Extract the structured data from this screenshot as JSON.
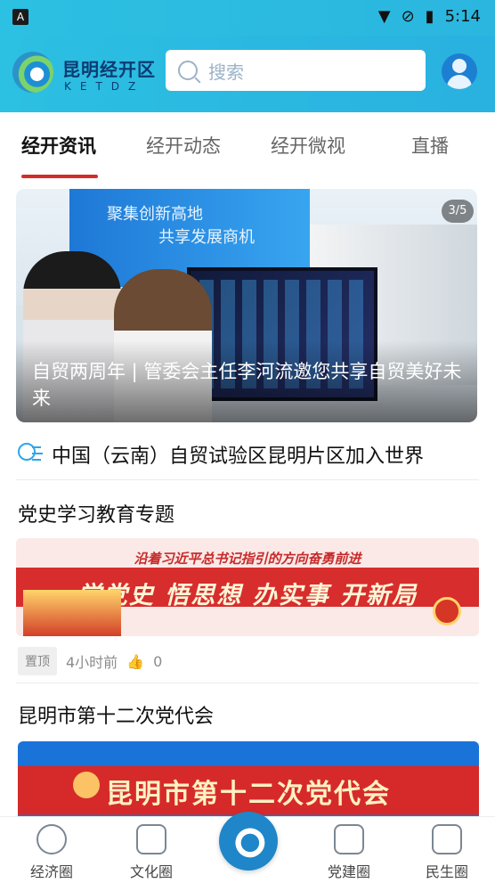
{
  "status_bar": {
    "left_badge": "A",
    "time": "5:14"
  },
  "header": {
    "brand_cn": "昆明经开区",
    "brand_en": "KETDZ",
    "search_placeholder": "搜索"
  },
  "tabs": [
    {
      "label": "经开资讯",
      "active": true
    },
    {
      "label": "经开动态",
      "active": false
    },
    {
      "label": "经开微视",
      "active": false
    },
    {
      "label": "直播",
      "active": false
    }
  ],
  "banner": {
    "title": "自贸两周年 | 管委会主任李河流邀您共享自贸美好未来",
    "counter": "3/5",
    "wall_text_1": "聚集创新高地",
    "wall_text_2": "共享发展商机"
  },
  "notice": {
    "text": "中国（云南）自贸试验区昆明片区加入世界"
  },
  "sections": [
    {
      "title": "党史学习教育专题",
      "poster_top": "沿着习近平总书记指引的方向奋勇前进",
      "poster_main": "学党史 悟思想 办实事 开新局",
      "tag": "置顶",
      "time": "4小时前",
      "likes": "0"
    },
    {
      "title": "昆明市第十二次党代会",
      "poster_main": "昆明市第十二次党代会"
    }
  ],
  "bottom_nav": [
    {
      "label": "经济圈",
      "icon": "globe-currency-icon"
    },
    {
      "label": "文化圈",
      "icon": "book-icon"
    },
    {
      "label": "",
      "icon": "center-logo-icon"
    },
    {
      "label": "党建圈",
      "icon": "id-card-icon"
    },
    {
      "label": "民生圈",
      "icon": "wallet-icon"
    }
  ],
  "colors": {
    "header": "#2cc0e2",
    "active_tab": "#111111",
    "tab_underline": "#d62b2b",
    "accent_blue": "#1f86c9"
  }
}
